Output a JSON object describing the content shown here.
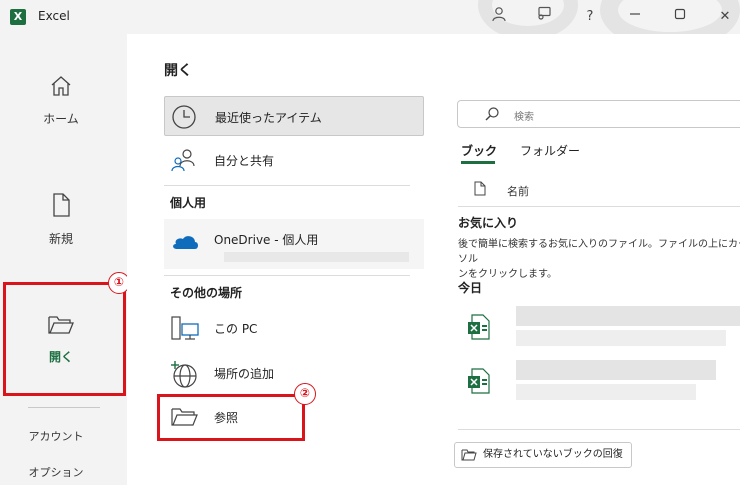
{
  "titlebar": {
    "app_icon": "X",
    "app_title": "Excel",
    "icons": [
      "user-icon",
      "feedback-icon",
      "help-icon",
      "minimize-icon",
      "maximize-icon",
      "close-icon"
    ],
    "help_label": "?",
    "close_label": "✕"
  },
  "nav": {
    "items": [
      {
        "label": "ホーム",
        "icon": "home-icon"
      },
      {
        "label": "新規",
        "icon": "new-file-icon"
      },
      {
        "label": "開く",
        "icon": "folder-open-icon"
      }
    ],
    "bottom": [
      {
        "label": "アカウント"
      },
      {
        "label": "オプション"
      }
    ]
  },
  "main": {
    "title": "開く",
    "locations": {
      "recent": "最近使ったアイテム",
      "shared": "自分と共有",
      "personal_header": "個人用",
      "onedrive": "OneDrive - 個人用",
      "other_header": "その他の場所",
      "this_pc": "この PC",
      "add_place": "場所の追加",
      "browse": "参照"
    },
    "search": {
      "placeholder": "検索"
    },
    "tabs": [
      "ブック",
      "フォルダー"
    ],
    "column_name": "名前",
    "favorites": {
      "title": "お気に入り",
      "description": "後で簡単に検索するお気に入りのファイル。ファイルの上にカーソル\nンをクリックします。"
    },
    "today": "今日",
    "recover_button": "保存されていないブックの回復"
  },
  "annotations": {
    "badge1": "①",
    "badge2": "②",
    "highlight_color": "#d9141b"
  },
  "colors": {
    "excel_green": "#1d6f42",
    "onedrive_blue": "#0f6cbd",
    "accent_red": "#d9141b"
  }
}
